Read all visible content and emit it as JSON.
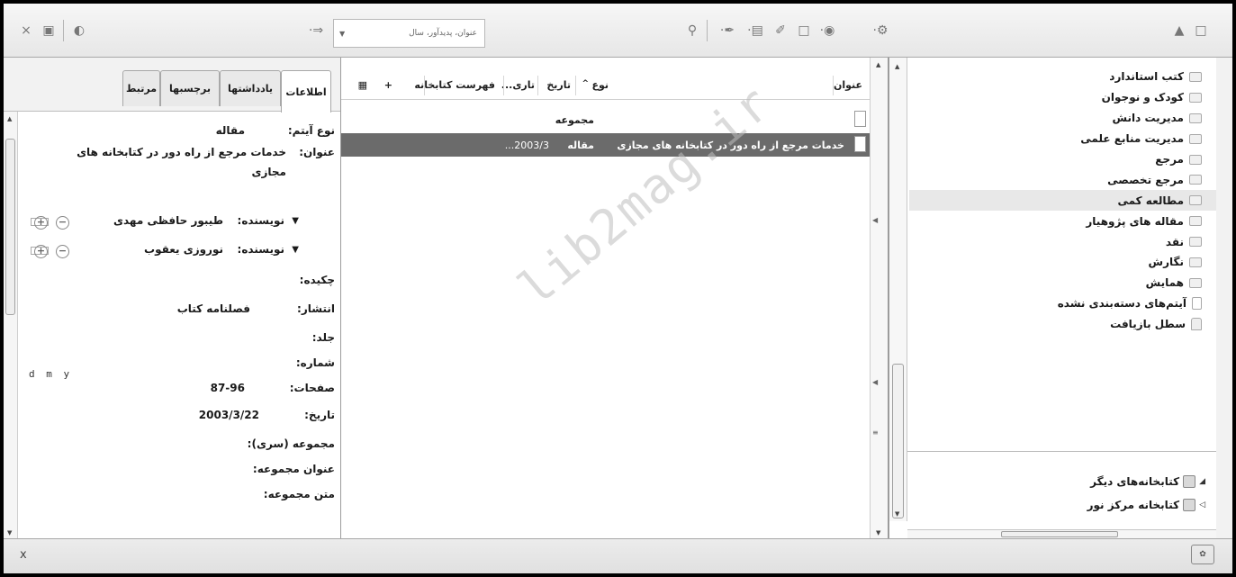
{
  "toolbar": {
    "search_placeholder": "عنوان، پدیدآور، سال"
  },
  "collections": [
    {
      "label": "کتب استاندارد",
      "icon": "folder-icon"
    },
    {
      "label": "کودک و نوجوان",
      "icon": "folder-icon"
    },
    {
      "label": "مدیریت دانش",
      "icon": "folder-icon"
    },
    {
      "label": "مدیریت منابع علمی",
      "icon": "folder-icon"
    },
    {
      "label": "مرجع",
      "icon": "folder-icon"
    },
    {
      "label": "مرجع تخصصی",
      "icon": "folder-icon"
    },
    {
      "label": "مطالعه کمی",
      "icon": "folder-icon",
      "selected": true
    },
    {
      "label": "مقاله های پژوهیار",
      "icon": "folder-icon"
    },
    {
      "label": "نقد",
      "icon": "folder-icon"
    },
    {
      "label": "نگارش",
      "icon": "folder-icon"
    },
    {
      "label": "همایش",
      "icon": "folder-icon"
    },
    {
      "label": "آیتم‌های دسته‌بندی نشده",
      "icon": "document-icon"
    },
    {
      "label": "سطل بازیافت",
      "icon": "trash-icon"
    }
  ],
  "libraries": {
    "other": "کتابخانه‌های دیگر",
    "noor": "کتابخانه مرکز نور"
  },
  "items": {
    "columns": {
      "title": "عنوان",
      "type": "نوع",
      "sort_arrow": "^",
      "date": "تاریخ",
      "date_added": "تاری...",
      "catalog": "فهرست کتابخانه",
      "plus": "+"
    },
    "rows": [
      {
        "title": "",
        "type": "مجموعه",
        "date": "",
        "selected": false
      },
      {
        "title": "خدمات مرجع از راه دور در کتابخانه های مجازی",
        "type": "مقاله",
        "date": "2003/3...",
        "selected": true
      }
    ]
  },
  "info": {
    "tabs": {
      "info": "اطلاعات",
      "notes": "یادداشتها",
      "tags": "برچسبها",
      "related": "مرتبط"
    },
    "item_type_label": "نوع آیتم:",
    "item_type_value": "مقاله",
    "title_label": "عنوان:",
    "title_value_line1": "خدمات مرجع از راه دور در کتابخانه های",
    "title_value_line2": "مجازی",
    "creators": [
      {
        "label": "نویسنده:",
        "name": "طیبور حافظی مهدی"
      },
      {
        "label": "نویسنده:",
        "name": "نوروزی یعقوب"
      }
    ],
    "abstract_label": "چکیده:",
    "publication_label": "انتشار:",
    "publication_value": "فصلنامه کتاب",
    "volume_label": "جلد:",
    "issue_label": "شماره:",
    "pages_label": "صفحات:",
    "pages_value": "87-96",
    "date_label": "تاریخ:",
    "date_value": "2003/3/22",
    "date_format": "d m y",
    "series_label": "مجموعه (سری):",
    "series_title_label": "عنوان مجموعه:",
    "series_text_label": "متن مجموعه:"
  },
  "status": {
    "close": "x"
  },
  "watermark": "lib2mag.ir"
}
